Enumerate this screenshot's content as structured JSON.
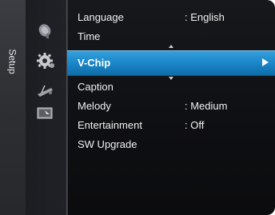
{
  "sidebar": {
    "tab_label": "Setup"
  },
  "icons": [
    "satellite-dish-icon",
    "gear-icon",
    "remote-icon",
    "picture-input-icon"
  ],
  "menu": {
    "items": [
      {
        "label": "Language",
        "value": ": English"
      },
      {
        "label": "Time",
        "value": ""
      },
      {
        "label": "V-Chip",
        "value": "",
        "selected": true
      },
      {
        "label": "Caption",
        "value": ""
      },
      {
        "label": "Melody",
        "value": ": Medium"
      },
      {
        "label": "Entertainment",
        "value": ": Off"
      },
      {
        "label": "SW Upgrade",
        "value": ""
      }
    ]
  },
  "colors": {
    "highlight": "#1b86c9",
    "background": "#0e0f12",
    "text": "#f0f0f0"
  }
}
